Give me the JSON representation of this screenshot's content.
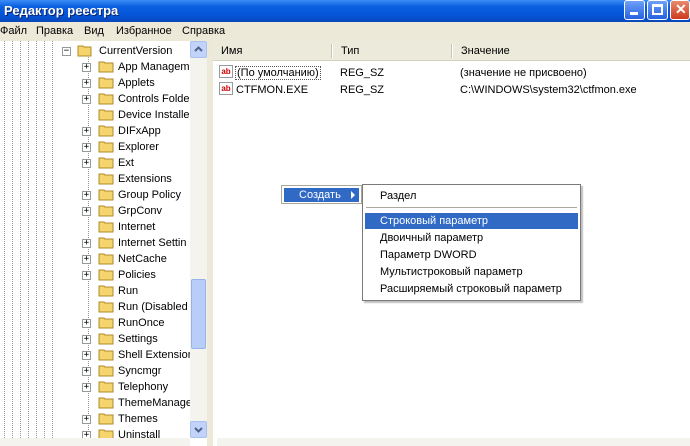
{
  "window": {
    "title": "Редактор реестра"
  },
  "menu": [
    "Файл",
    "Правка",
    "Вид",
    "Избранное",
    "Справка"
  ],
  "tree": {
    "parent": "CurrentVersion",
    "items": [
      {
        "label": "App Manageme",
        "expander": "+"
      },
      {
        "label": "Applets",
        "expander": "+"
      },
      {
        "label": "Controls Folder",
        "expander": "+"
      },
      {
        "label": "Device Installer",
        "expander": ""
      },
      {
        "label": "DIFxApp",
        "expander": "+"
      },
      {
        "label": "Explorer",
        "expander": "+"
      },
      {
        "label": "Ext",
        "expander": "+"
      },
      {
        "label": "Extensions",
        "expander": ""
      },
      {
        "label": "Group Policy",
        "expander": "+"
      },
      {
        "label": "GrpConv",
        "expander": "+"
      },
      {
        "label": "Internet",
        "expander": ""
      },
      {
        "label": "Internet Settin",
        "expander": "+"
      },
      {
        "label": "NetCache",
        "expander": "+"
      },
      {
        "label": "Policies",
        "expander": "+"
      },
      {
        "label": "Run",
        "expander": ""
      },
      {
        "label": "Run (Disabled b",
        "expander": ""
      },
      {
        "label": "RunOnce",
        "expander": "+"
      },
      {
        "label": "Settings",
        "expander": "+"
      },
      {
        "label": "Shell Extension",
        "expander": "+"
      },
      {
        "label": "Syncmgr",
        "expander": "+"
      },
      {
        "label": "Telephony",
        "expander": "+"
      },
      {
        "label": "ThemeManager",
        "expander": ""
      },
      {
        "label": "Themes",
        "expander": "+"
      },
      {
        "label": "Uninstall",
        "expander": "+"
      }
    ]
  },
  "columns": {
    "name": "Имя",
    "type": "Тип",
    "value": "Значение"
  },
  "rows": [
    {
      "name": "(По умолчанию)",
      "type": "REG_SZ",
      "value": "(значение не присвоено)"
    },
    {
      "name": "CTFMON.EXE",
      "type": "REG_SZ",
      "value": "C:\\WINDOWS\\system32\\ctfmon.exe"
    }
  ],
  "context_menu": {
    "create_label": "Создать",
    "submenu": [
      "Раздел",
      "Строковый параметр",
      "Двоичный параметр",
      "Параметр DWORD",
      "Мультистроковый параметр",
      "Расширяемый строковый параметр"
    ],
    "highlighted_index": 1
  },
  "icons": {
    "string_value": "ab"
  },
  "colors": {
    "titlebar": "#0554d8",
    "selection": "#316ac5",
    "folder": "#f5d46b"
  }
}
